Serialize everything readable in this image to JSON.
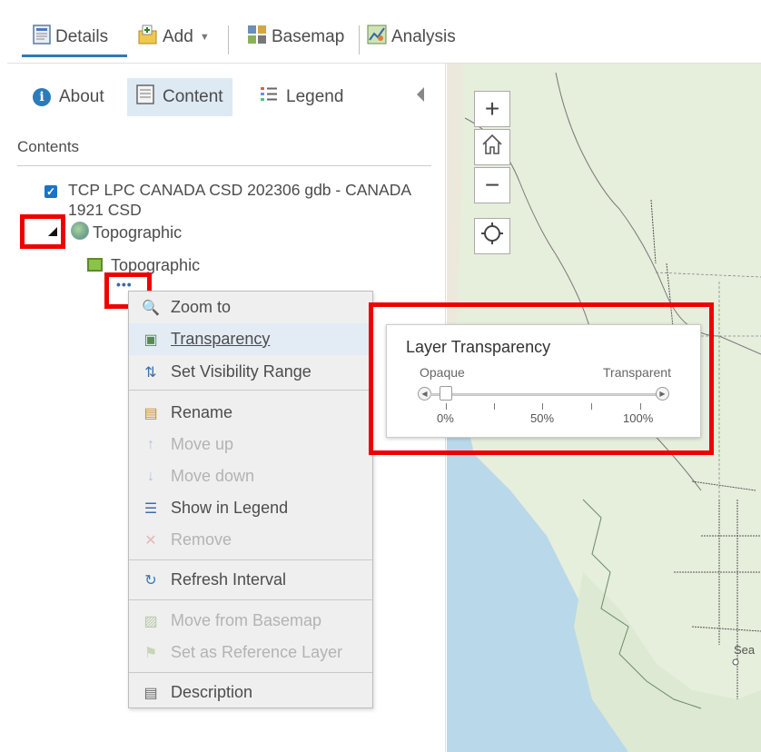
{
  "toolbar": {
    "details_label": "Details",
    "add_label": "Add",
    "basemap_label": "Basemap",
    "analysis_label": "Analysis"
  },
  "panel": {
    "tabs": [
      {
        "label": "About"
      },
      {
        "label": "Content"
      },
      {
        "label": "Legend"
      }
    ],
    "contents_title": "Contents",
    "layer": {
      "title": "TCP LPC CANADA CSD 202306 gdb - CANADA 1921 CSD",
      "checked": true,
      "sublayer": "Topographic",
      "subsublayer": "Topographic",
      "more_glyph": "•••"
    }
  },
  "menu": {
    "items": [
      {
        "label": "Zoom to",
        "icon": "zoom-to-icon",
        "enabled": true
      },
      {
        "label": "Transparency",
        "icon": "transparency-icon",
        "enabled": true,
        "highlighted": true
      },
      {
        "label": "Set Visibility Range",
        "icon": "visibility-range-icon",
        "enabled": true
      },
      {
        "label": "Rename",
        "icon": "rename-icon",
        "enabled": true
      },
      {
        "label": "Move up",
        "icon": "arrow-up-icon",
        "enabled": false
      },
      {
        "label": "Move down",
        "icon": "arrow-down-icon",
        "enabled": false
      },
      {
        "label": "Show in Legend",
        "icon": "legend-icon",
        "enabled": true
      },
      {
        "label": "Remove",
        "icon": "remove-icon",
        "enabled": false
      },
      {
        "label": "Refresh Interval",
        "icon": "refresh-icon",
        "enabled": true
      },
      {
        "label": "Move from Basemap",
        "icon": "move-basemap-icon",
        "enabled": false
      },
      {
        "label": "Set as Reference Layer",
        "icon": "reference-layer-icon",
        "enabled": false
      },
      {
        "label": "Description",
        "icon": "description-icon",
        "enabled": true
      }
    ]
  },
  "transparency": {
    "title": "Layer Transparency",
    "left_label": "Opaque",
    "right_label": "Transparent",
    "ticks": [
      "0%",
      "50%",
      "100%"
    ],
    "value": 0
  },
  "map": {
    "zoom_in": "+",
    "zoom_out": "−",
    "city_label": "Sea"
  },
  "colors": {
    "accent": "#2b7bb9",
    "highlight_box": "#ee0000",
    "checkbox": "#1a73c7",
    "active_tab": "#dde9f3"
  }
}
